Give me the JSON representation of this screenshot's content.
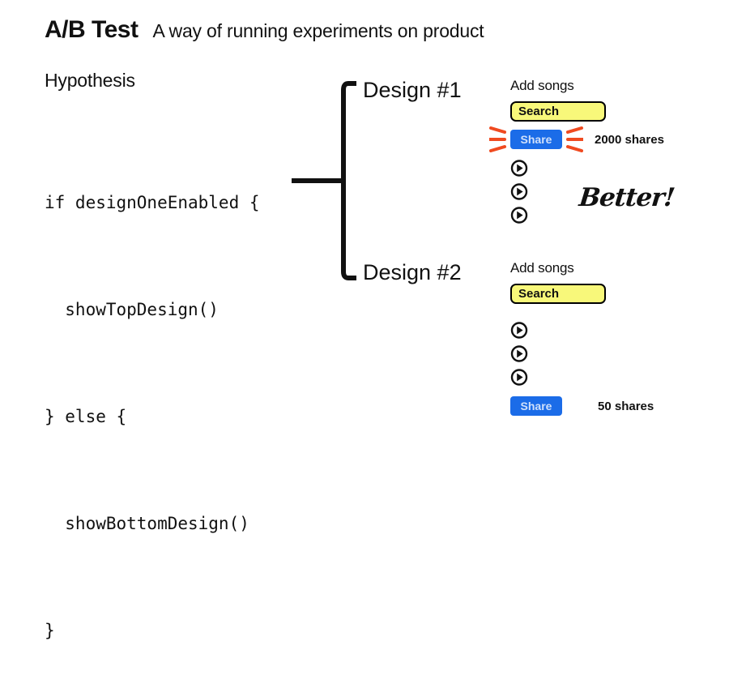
{
  "header": {
    "title": "A/B Test",
    "subtitle": "A way of running experiments on product"
  },
  "hypothesis": {
    "label": "Hypothesis",
    "code_lines": [
      "if designOneEnabled {",
      "  showTopDesign()",
      "} else {",
      "  showBottomDesign()",
      "}"
    ]
  },
  "annotation": {
    "better_text": "Better!"
  },
  "colors": {
    "search_fill": "#f8f87a",
    "search_border": "#000000",
    "share_button": "#1b6ce8",
    "share_button_text": "#cfe0fb",
    "sparkle": "#f04a20",
    "text": "#111111",
    "background": "#ffffff"
  },
  "variants": [
    {
      "label": "Design #1",
      "add_songs_label": "Add songs",
      "search_value": "Search",
      "share_label": "Share",
      "shares_count": "2000 shares",
      "play_items": [
        "play-icon",
        "play-icon",
        "play-icon"
      ],
      "highlighted": true
    },
    {
      "label": "Design #2",
      "add_songs_label": "Add songs",
      "search_value": "Search",
      "share_label": "Share",
      "shares_count": "50 shares",
      "play_items": [
        "play-icon",
        "play-icon",
        "play-icon"
      ],
      "highlighted": false
    }
  ]
}
